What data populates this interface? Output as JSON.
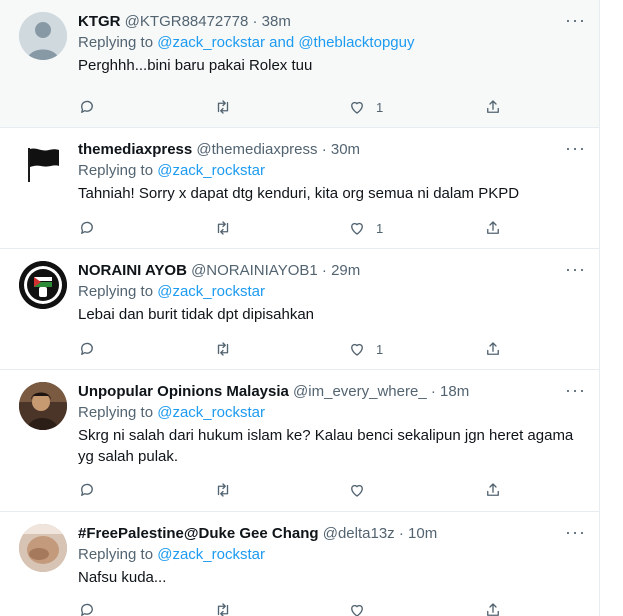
{
  "colors": {
    "link": "#1d9bf0",
    "muted": "#536471",
    "text": "#0f1419",
    "highlight": "#f7f9f9",
    "divider": "#e6ecf0"
  },
  "icons": {
    "reply": "reply-icon",
    "retweet": "retweet-icon",
    "like": "heart-icon",
    "share": "share-icon",
    "more": "more-icon"
  },
  "tweets": [
    {
      "name": "KTGR",
      "handle": "@KTGR88472778",
      "sep": " · ",
      "time": "38m",
      "replying_prefix": "Replying to ",
      "replying_to": "@zack_rockstar and @theblacktopguy",
      "text": "Perghhh...bini baru pakai Rolex tuu",
      "like_count": "1",
      "more": "···"
    },
    {
      "name": "themediaxpress",
      "handle": "@themediaxpress",
      "sep": " · ",
      "time": "30m",
      "replying_prefix": "Replying to ",
      "replying_to": "@zack_rockstar",
      "text": "Tahniah! Sorry x dapat dtg kenduri, kita org semua ni dalam PKPD",
      "like_count": "1",
      "more": "···"
    },
    {
      "name": "NORAINI AYOB",
      "handle": "@NORAINIAYOB1",
      "sep": " · ",
      "time": "29m",
      "replying_prefix": "Replying to ",
      "replying_to": "@zack_rockstar",
      "text": "Lebai dan burit tidak dpt dipisahkan",
      "like_count": "1",
      "more": "···"
    },
    {
      "name": "Unpopular Opinions Malaysia",
      "handle": "@im_every_where_",
      "sep": " · ",
      "time": "18m",
      "replying_prefix": "Replying to ",
      "replying_to": "@zack_rockstar",
      "text": "Skrg ni salah dari hukum islam ke? Kalau benci sekalipun jgn heret agama yg salah pulak.",
      "like_count": "",
      "more": "···"
    },
    {
      "name": "#FreePalestine@Duke Gee Chang",
      "handle": "@delta13z",
      "sep": " · ",
      "time": "10m",
      "replying_prefix": "Replying to ",
      "replying_to": "@zack_rockstar",
      "text": "Nafsu kuda...",
      "like_count": "",
      "more": "···"
    }
  ]
}
